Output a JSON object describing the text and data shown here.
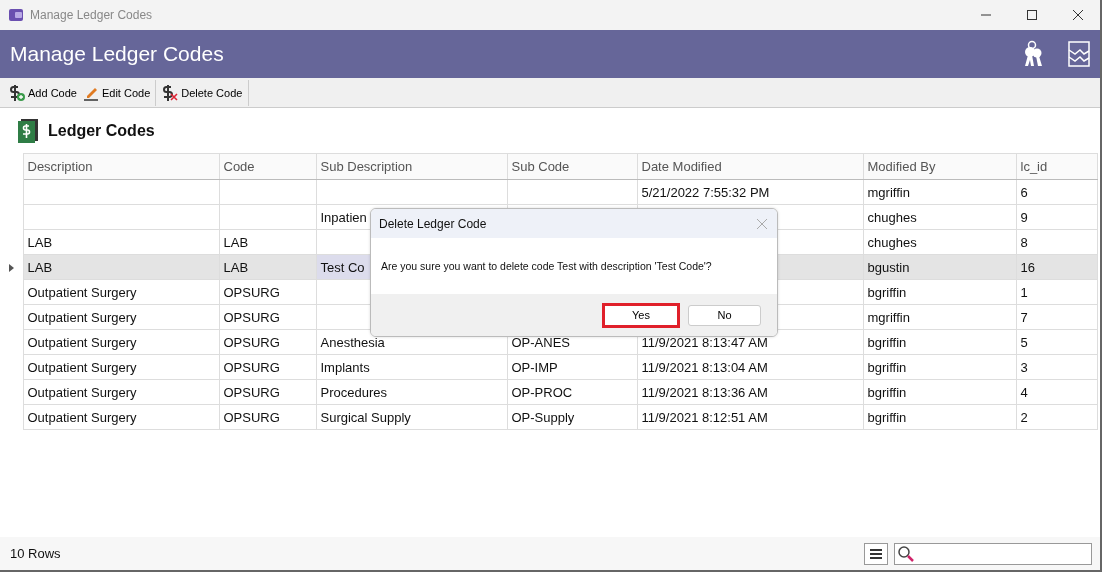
{
  "window": {
    "title": "Manage Ledger Codes"
  },
  "header": {
    "title": "Manage Ledger Codes"
  },
  "toolbar": [
    {
      "label": "Add Code",
      "kind": "add"
    },
    {
      "label": "Edit Code",
      "kind": "edit"
    },
    {
      "label": "Delete Code",
      "kind": "delete"
    }
  ],
  "section": {
    "title": "Ledger Codes"
  },
  "table": {
    "columns": [
      "Description",
      "Code",
      "Sub Description",
      "Sub Code",
      "Date Modified",
      "Modified By",
      "lc_id"
    ],
    "rows": [
      {
        "selected": false,
        "cells": [
          null,
          null,
          null,
          null,
          "5/21/2022 7:55:32 PM",
          "mgriffin",
          "6"
        ]
      },
      {
        "selected": false,
        "cells": [
          null,
          null,
          "Inpatien",
          null,
          null,
          "chughes",
          "9"
        ]
      },
      {
        "selected": false,
        "cells": [
          "LAB",
          "LAB",
          null,
          null,
          null,
          "chughes",
          "8"
        ]
      },
      {
        "selected": true,
        "cells": [
          "LAB",
          "LAB",
          {
            "text": "Test Co",
            "focused": true
          },
          null,
          null,
          "bgustin",
          "16"
        ]
      },
      {
        "selected": false,
        "cells": [
          "Outpatient Surgery",
          "OPSURG",
          null,
          null,
          null,
          "bgriffin",
          "1"
        ]
      },
      {
        "selected": false,
        "cells": [
          "Outpatient Surgery",
          "OPSURG",
          null,
          null,
          null,
          "mgriffin",
          "7"
        ]
      },
      {
        "selected": false,
        "cells": [
          "Outpatient Surgery",
          "OPSURG",
          "Anesthesia",
          "OP-ANES",
          "11/9/2021 8:13:47 AM",
          "bgriffin",
          "5"
        ]
      },
      {
        "selected": false,
        "cells": [
          "Outpatient Surgery",
          "OPSURG",
          "Implants",
          "OP-IMP",
          "11/9/2021 8:13:04 AM",
          "bgriffin",
          "3"
        ]
      },
      {
        "selected": false,
        "cells": [
          "Outpatient Surgery",
          "OPSURG",
          "Procedures",
          "OP-PROC",
          "11/9/2021 8:13:36 AM",
          "bgriffin",
          "4"
        ]
      },
      {
        "selected": false,
        "cells": [
          "Outpatient Surgery",
          "OPSURG",
          "Surgical Supply",
          "OP-Supply",
          "11/9/2021 8:12:51 AM",
          "bgriffin",
          "2"
        ]
      }
    ]
  },
  "dialog": {
    "title": "Delete Ledger Code",
    "message": "Are you sure you want to delete code Test with description 'Test Code'?",
    "buttons": [
      {
        "label": "Yes",
        "highlighted": true
      },
      {
        "label": "No",
        "highlighted": false
      }
    ]
  },
  "status_bar": {
    "count": "10 Rows"
  }
}
